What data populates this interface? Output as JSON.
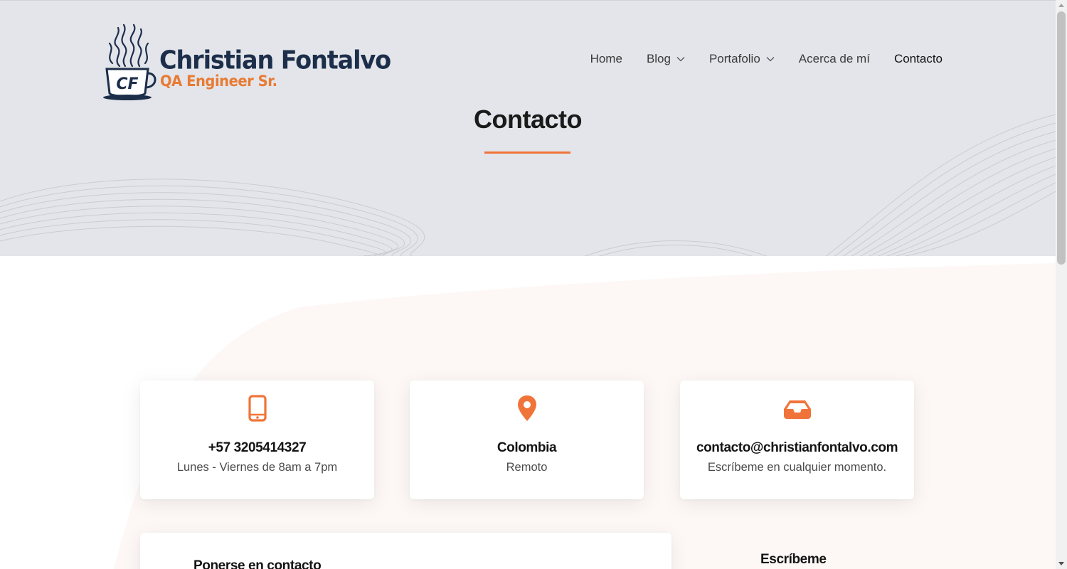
{
  "brand": {
    "name": "Christian Fontalvo",
    "role": "QA Engineer Sr.",
    "monogram": "CF",
    "colors": {
      "navy": "#1c2e4a",
      "orange": "#e87b33"
    }
  },
  "nav": {
    "items": [
      {
        "label": "Home"
      },
      {
        "label": "Blog",
        "has_dropdown": true
      },
      {
        "label": "Portafolio",
        "has_dropdown": true
      },
      {
        "label": "Acerca de mí"
      },
      {
        "label": "Contacto",
        "active": true
      }
    ]
  },
  "hero": {
    "title": "Contacto",
    "accent_color": "#f0743a"
  },
  "contact_cards": [
    {
      "icon": "mobile-phone-icon",
      "title": "+57 3205414327",
      "subtitle": "Lunes - Viernes de 8am a 7pm"
    },
    {
      "icon": "map-pin-icon",
      "title": "Colombia",
      "subtitle": "Remoto"
    },
    {
      "icon": "inbox-icon",
      "title": "contacto@christianfontalvo.com",
      "subtitle": "Escríbeme en cualquier momento."
    }
  ],
  "form": {
    "title": "Ponerse en contacto"
  },
  "side": {
    "title": "Escríbeme"
  }
}
